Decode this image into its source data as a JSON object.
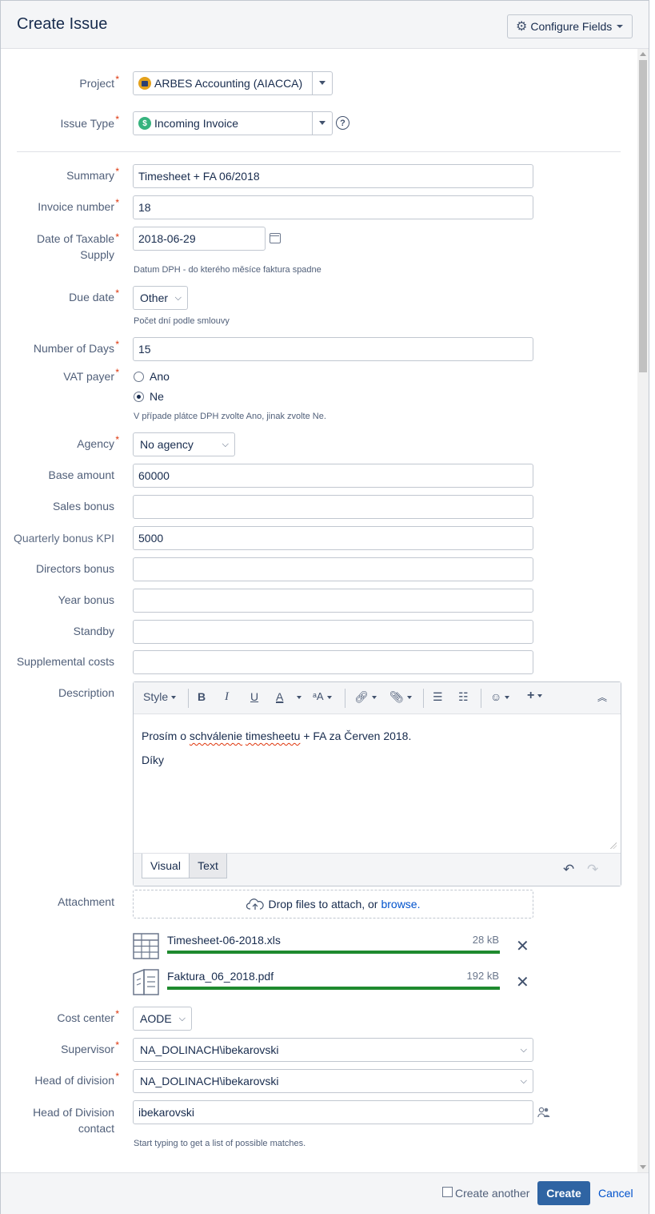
{
  "dialog": {
    "title": "Create Issue",
    "configure_fields_label": "Configure Fields"
  },
  "fields": {
    "project": {
      "label": "Project",
      "value": "ARBES Accounting (AIACCA)"
    },
    "issue_type": {
      "label": "Issue Type",
      "value": "Incoming Invoice"
    },
    "summary": {
      "label": "Summary",
      "value": "Timesheet + FA 06/2018"
    },
    "invoice_number": {
      "label": "Invoice number",
      "value": "18"
    },
    "date_taxable": {
      "label": "Date of Taxable Supply",
      "value": "2018-06-29",
      "help": "Datum DPH - do kterého měsíce faktura spadne"
    },
    "due_date": {
      "label": "Due date",
      "value": "Other",
      "help": "Počet dní podle smlouvy"
    },
    "number_of_days": {
      "label": "Number of Days",
      "value": "15"
    },
    "vat_payer": {
      "label": "VAT payer",
      "options": [
        "Ano",
        "Ne"
      ],
      "selected": "Ne",
      "help": "V případe plátce DPH zvolte Ano, jinak zvolte Ne."
    },
    "agency": {
      "label": "Agency",
      "value": "No agency"
    },
    "base_amount": {
      "label": "Base amount",
      "value": "60000"
    },
    "sales_bonus": {
      "label": "Sales bonus",
      "value": ""
    },
    "quarterly_bonus": {
      "label": "Quarterly bonus KPI",
      "value": "5000"
    },
    "directors_bonus": {
      "label": "Directors bonus",
      "value": ""
    },
    "year_bonus": {
      "label": "Year bonus",
      "value": ""
    },
    "standby": {
      "label": "Standby",
      "value": ""
    },
    "supplemental_costs": {
      "label": "Supplemental costs",
      "value": ""
    },
    "description": {
      "label": "Description",
      "toolbar": {
        "style": "Style",
        "bold": "B",
        "italic": "I",
        "underline": "U",
        "text_color": "A"
      },
      "content_pre": "Prosím o ",
      "content_w1": "schválenie",
      "content_mid": " ",
      "content_w2": "timesheetu",
      "content_post": " + FA za Červen 2018.",
      "content_line2": "Díky",
      "tabs": [
        "Visual",
        "Text"
      ],
      "active_tab": "Visual"
    },
    "attachment": {
      "label": "Attachment",
      "drop_text": "Drop files to attach, or",
      "browse_text": "browse.",
      "files": [
        {
          "name": "Timesheet-06-2018.xls",
          "size": "28 kB",
          "progress": 1.0
        },
        {
          "name": "Faktura_06_2018.pdf",
          "size": "192 kB",
          "progress": 1.0
        }
      ]
    },
    "cost_center": {
      "label": "Cost center",
      "value": "AODE"
    },
    "supervisor": {
      "label": "Supervisor",
      "value": "NA_DOLINACH\\ibekarovski"
    },
    "head_of_division": {
      "label": "Head of division",
      "value": "NA_DOLINACH\\ibekarovski"
    },
    "head_of_division_contact": {
      "label": "Head of Division contact",
      "value": "ibekarovski",
      "help": "Start typing to get a list of possible matches."
    }
  },
  "footer": {
    "create_another_label": "Create another",
    "create_label": "Create",
    "cancel_label": "Cancel"
  },
  "colors": {
    "primary_button": "#2f64a3",
    "link": "#0052cc",
    "required": "#de350b",
    "progress": "#1e8a2e"
  }
}
